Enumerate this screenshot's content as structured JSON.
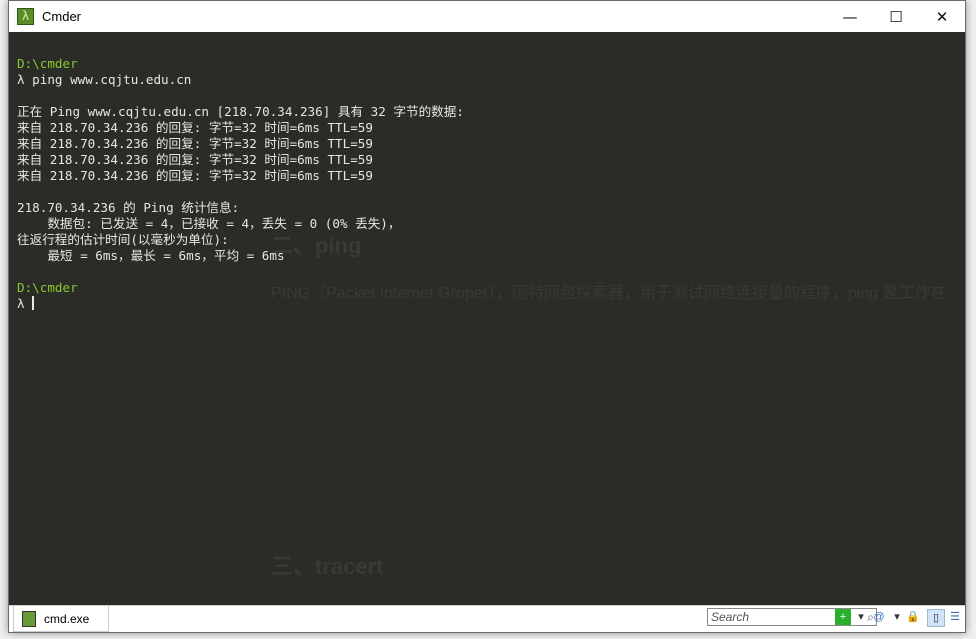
{
  "window": {
    "title": "Cmder",
    "minimize": "—",
    "maximize": "☐",
    "close": "✕"
  },
  "terminal": {
    "lines": [
      {
        "type": "path",
        "text": "D:\\cmder"
      },
      {
        "type": "text",
        "text": "λ ping www.cqjtu.edu.cn"
      },
      {
        "type": "text",
        "text": ""
      },
      {
        "type": "text",
        "text": "正在 Ping www.cqjtu.edu.cn [218.70.34.236] 具有 32 字节的数据:"
      },
      {
        "type": "text",
        "text": "来自 218.70.34.236 的回复: 字节=32 时间=6ms TTL=59"
      },
      {
        "type": "text",
        "text": "来自 218.70.34.236 的回复: 字节=32 时间=6ms TTL=59"
      },
      {
        "type": "text",
        "text": "来自 218.70.34.236 的回复: 字节=32 时间=6ms TTL=59"
      },
      {
        "type": "text",
        "text": "来自 218.70.34.236 的回复: 字节=32 时间=6ms TTL=59"
      },
      {
        "type": "text",
        "text": ""
      },
      {
        "type": "text",
        "text": "218.70.34.236 的 Ping 统计信息:"
      },
      {
        "type": "text",
        "text": "    数据包: 已发送 = 4，已接收 = 4，丢失 = 0 (0% 丢失)，"
      },
      {
        "type": "text",
        "text": "往返行程的估计时间(以毫秒为单位):"
      },
      {
        "type": "text",
        "text": "    最短 = 6ms，最长 = 6ms，平均 = 6ms"
      },
      {
        "type": "text",
        "text": ""
      },
      {
        "type": "path",
        "text": "D:\\cmder"
      },
      {
        "type": "cursor",
        "text": "λ "
      }
    ],
    "background_text": {
      "heading_ping": "二、ping",
      "para_ping": "PING（Packet Internet Groper），因特网包探索器，用于测试网络连接量的程序，ping 是工作在",
      "heading_tracert": "三、tracert"
    }
  },
  "statusbar": {
    "tab_label": "cmd.exe",
    "search_placeholder": "Search",
    "search_icon": "magnifier"
  },
  "colors": {
    "terminal_bg": "#2b2b27",
    "prompt_path": "#8ac82c",
    "text": "#e6e6e6"
  }
}
